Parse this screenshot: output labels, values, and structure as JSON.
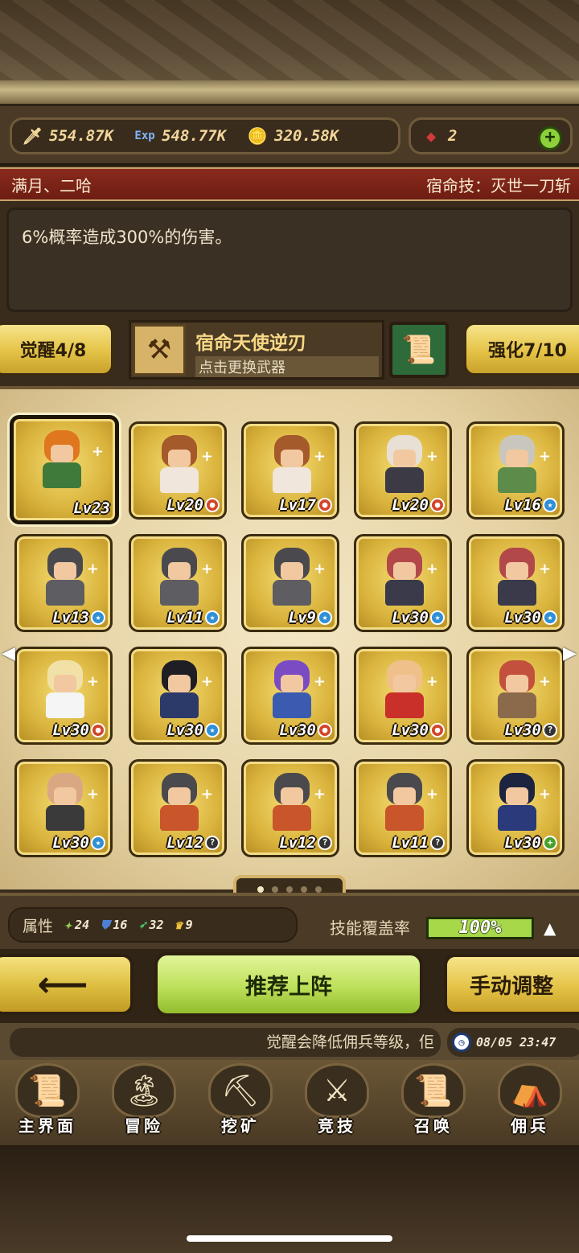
{
  "resources": {
    "attack": "554.87K",
    "exp": "548.77K",
    "gold": "320.58K",
    "gems": "2"
  },
  "fate": {
    "team": "满月、二哈",
    "skill": "宿命技：灭世一刀斩",
    "description": "6%概率造成300%的伤害。"
  },
  "weapon": {
    "awaken_label": "觉醒4/8",
    "name": "宿命天使逆刃",
    "change_hint": "点击更换武器",
    "enhance_label": "强化7/10"
  },
  "heroes": [
    {
      "level": "Lv23",
      "badge": "",
      "hair": "#e0761e",
      "outfit": "#3f7a3a",
      "selected": true
    },
    {
      "level": "Lv20",
      "badge": "red",
      "hair": "#a45a2a",
      "outfit": "#f0e6dc"
    },
    {
      "level": "Lv17",
      "badge": "red",
      "hair": "#a45a2a",
      "outfit": "#f0e6dc"
    },
    {
      "level": "Lv20",
      "badge": "red",
      "hair": "#e8e0d4",
      "outfit": "#3c3a44"
    },
    {
      "level": "Lv16",
      "badge": "blue",
      "hair": "#c9c7bd",
      "outfit": "#5d8c4a"
    },
    {
      "level": "Lv13",
      "badge": "blue",
      "hair": "#4a4a4e",
      "outfit": "#5d5d62"
    },
    {
      "level": "Lv11",
      "badge": "blue",
      "hair": "#4a4a4e",
      "outfit": "#5d5d62"
    },
    {
      "level": "Lv9",
      "badge": "blue",
      "hair": "#4a4a4e",
      "outfit": "#5d5d62"
    },
    {
      "level": "Lv30",
      "badge": "blue",
      "hair": "#b3484a",
      "outfit": "#3a3a4a"
    },
    {
      "level": "Lv30",
      "badge": "blue",
      "hair": "#b3484a",
      "outfit": "#3a3a4a"
    },
    {
      "level": "Lv30",
      "badge": "red",
      "hair": "#f2e1a6",
      "outfit": "#f5f5f5"
    },
    {
      "level": "Lv30",
      "badge": "blue",
      "hair": "#1e1e24",
      "outfit": "#2c3a6a"
    },
    {
      "level": "Lv30",
      "badge": "red",
      "hair": "#7b4bc4",
      "outfit": "#3a5bb0"
    },
    {
      "level": "Lv30",
      "badge": "red",
      "hair": "#f0c08a",
      "outfit": "#c9302a"
    },
    {
      "level": "Lv30",
      "badge": "gray",
      "hair": "#c2503c",
      "outfit": "#8a6a4a"
    },
    {
      "level": "Lv30",
      "badge": "blue",
      "hair": "#d9a883",
      "outfit": "#3a3a3a"
    },
    {
      "level": "Lv12",
      "badge": "gray",
      "hair": "#4a4a4e",
      "outfit": "#c8562a"
    },
    {
      "level": "Lv12",
      "badge": "gray",
      "hair": "#4a4a4e",
      "outfit": "#c8562a"
    },
    {
      "level": "Lv11",
      "badge": "gray",
      "hair": "#4a4a4e",
      "outfit": "#c8562a"
    },
    {
      "level": "Lv30",
      "badge": "green",
      "hair": "#1c2440",
      "outfit": "#2a3a7a"
    }
  ],
  "attributes": {
    "label": "属性",
    "values": [
      "24",
      "16",
      "32",
      "9"
    ],
    "coverage_label": "技能覆盖率",
    "coverage_value": "100%"
  },
  "actions": {
    "back": "⟵",
    "recommend": "推荐上阵",
    "manual": "手动调整"
  },
  "ticker": {
    "text": "觉醒会降低佣兵等级，佢",
    "time": "08/05 23:47"
  },
  "nav": [
    {
      "label": "主界面",
      "icon": "📜"
    },
    {
      "label": "冒险",
      "icon": "🏝"
    },
    {
      "label": "挖矿",
      "icon": "⛏"
    },
    {
      "label": "竞技",
      "icon": "⚔"
    },
    {
      "label": "召唤",
      "icon": "📜"
    },
    {
      "label": "佣兵",
      "icon": "⛺"
    }
  ]
}
